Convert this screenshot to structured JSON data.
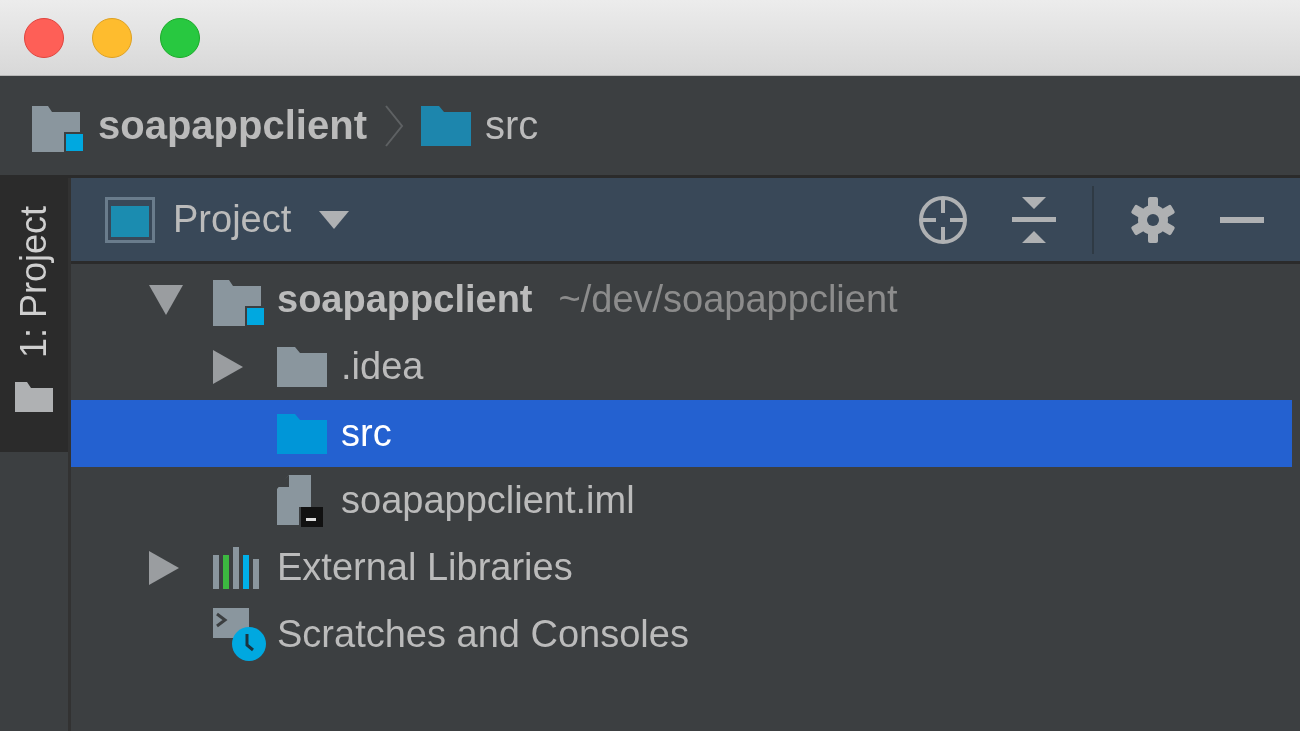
{
  "window": {
    "controls": [
      {
        "kind": "close"
      },
      {
        "kind": "minimize"
      },
      {
        "kind": "zoom"
      }
    ]
  },
  "breadcrumbs": [
    {
      "label": "soapappclient",
      "kind": "module"
    },
    {
      "label": "src",
      "kind": "source-folder"
    }
  ],
  "tool_strip": {
    "tabs": [
      {
        "label": "1: Project",
        "selected": true
      }
    ]
  },
  "panel": {
    "title": "Project",
    "toolbar": [
      {
        "kind": "locate"
      },
      {
        "kind": "collapse"
      },
      {
        "kind": "separator"
      },
      {
        "kind": "settings"
      },
      {
        "kind": "minimize"
      }
    ]
  },
  "tree": [
    {
      "label": "soapappclient",
      "path": "~/dev/soapappclient",
      "kind": "module",
      "expanded": true,
      "selected": false,
      "children": [
        {
          "label": ".idea",
          "kind": "folder",
          "expanded": false,
          "selected": false
        },
        {
          "label": "src",
          "kind": "source-folder",
          "selected": true
        },
        {
          "label": "soapappclient.iml",
          "kind": "file",
          "selected": false
        }
      ]
    },
    {
      "label": "External Libraries",
      "kind": "libraries",
      "expanded": false,
      "selected": false
    },
    {
      "label": "Scratches and Consoles",
      "kind": "scratches",
      "selected": false
    }
  ]
}
